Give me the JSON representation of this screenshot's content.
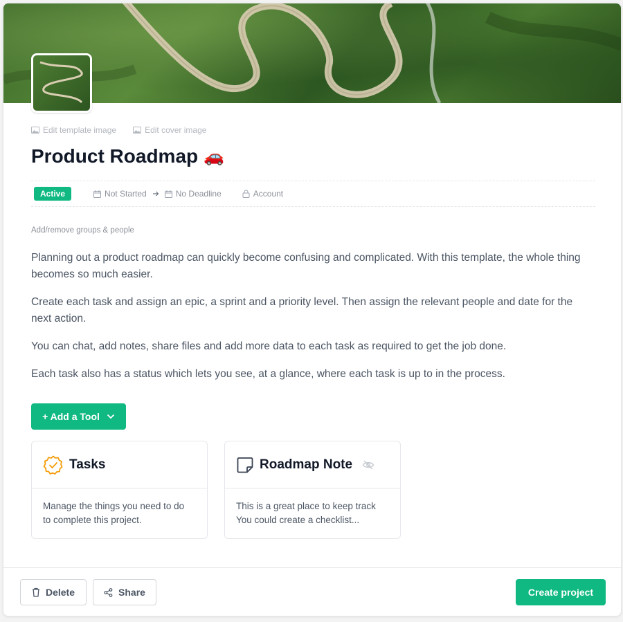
{
  "cover": {
    "alt": "winding mountain road cover image"
  },
  "edit_links": {
    "template_image": "Edit template image",
    "cover_image": "Edit cover image"
  },
  "project": {
    "title": "Product Roadmap",
    "title_emoji": "🚗",
    "status": "Active",
    "start": "Not Started",
    "deadline": "No Deadline",
    "visibility": "Account"
  },
  "groups_link": "Add/remove groups & people",
  "description": [
    "Planning out a product roadmap can quickly become confusing and complicated. With this template, the whole thing becomes so much easier.",
    "Create each task and assign an epic, a sprint and a priority level. Then assign the relevant people and date for the next action.",
    "You can chat, add notes, share files and add more data to each task as required to get the job done.",
    "Each task also has a status which lets you see, at a glance, where each task is up to in the process."
  ],
  "add_tool_label": "+ Add a Tool",
  "tools": [
    {
      "name": "Tasks",
      "icon": "check-badge-icon",
      "text_1": "Manage the things you need to do",
      "text_2": "to complete this project."
    },
    {
      "name": "Roadmap Note",
      "icon": "note-icon",
      "text_1": "This is a great place to keep track",
      "text_2": "You could create a checklist..."
    }
  ],
  "footer": {
    "delete_label": "Delete",
    "share_label": "Share",
    "create_label": "Create project"
  },
  "colors": {
    "accent": "#10b981",
    "tasks_icon": "#f59e0b",
    "title": "#111827",
    "muted": "#8b9099"
  }
}
